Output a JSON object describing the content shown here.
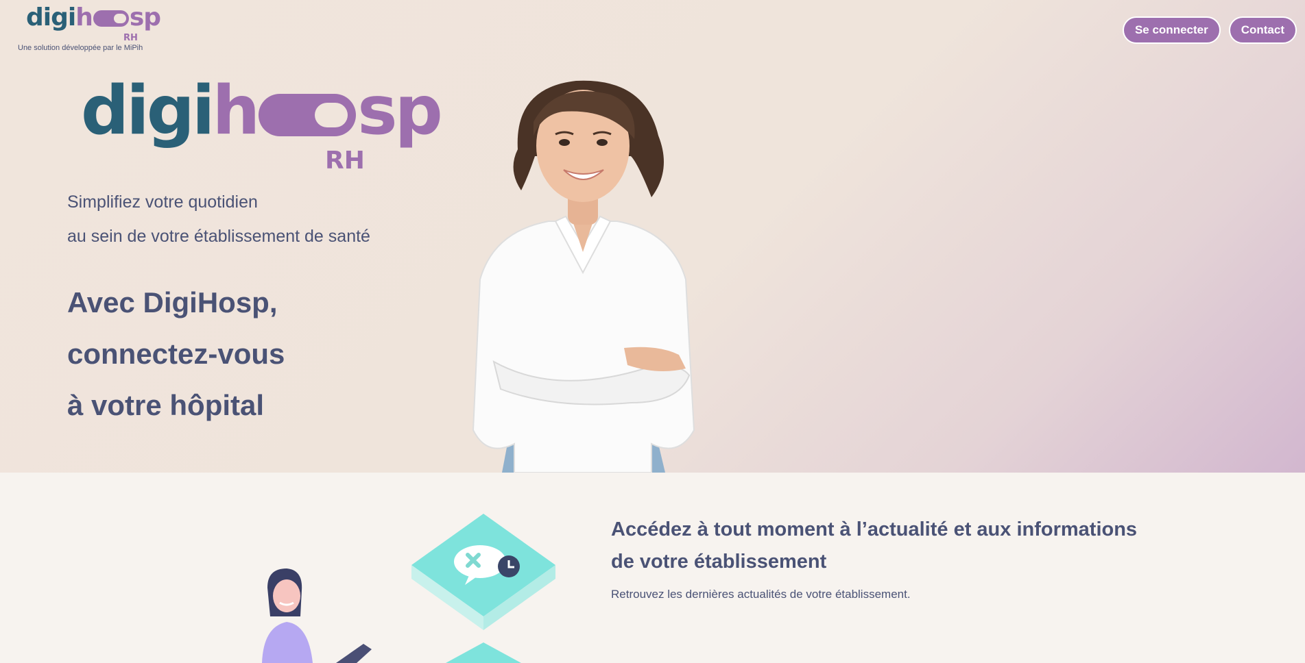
{
  "header": {
    "logo": {
      "part1": "digi",
      "h": "h",
      "part2": "sp",
      "rh": "RH"
    },
    "tagline": "Une solution développée par le MiPih",
    "nav": {
      "login": "Se connecter",
      "contact": "Contact"
    }
  },
  "hero": {
    "logo": {
      "part1": "digi",
      "h": "h",
      "part2": "sp",
      "rh": "RH"
    },
    "subtitle": [
      "Simplifiez votre quotidien",
      "au sein de votre établissement de santé"
    ],
    "headline": [
      "Avec DigiHosp,",
      "connectez-vous",
      "à votre hôpital"
    ]
  },
  "feature": {
    "title_line1": "Accédez à tout moment à l’actualité et aux informations",
    "title_line2": "de votre établissement",
    "text": "Retrouvez les dernières actualités de votre établissement."
  },
  "colors": {
    "brand_teal": "#2a6077",
    "brand_purple": "#9d6fae",
    "text": "#4a5275",
    "accent_mint": "#7ee3dc"
  },
  "icons": [
    "chat-bubble-icon",
    "close-x-icon",
    "clock-icon"
  ]
}
